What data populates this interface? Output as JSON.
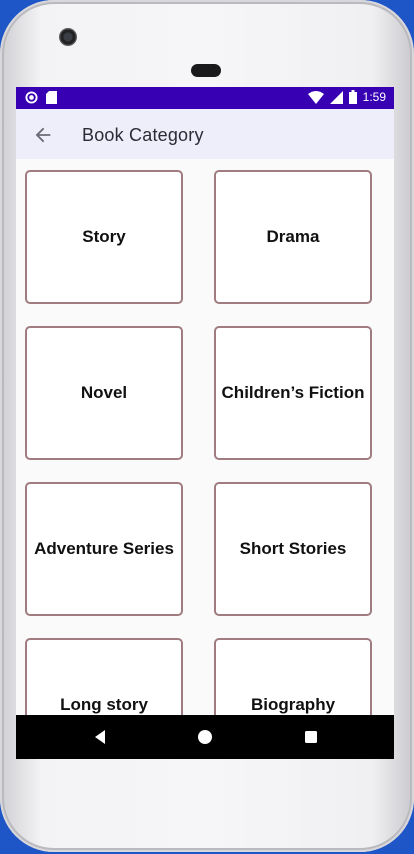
{
  "status_bar": {
    "time": "1:59",
    "icons": [
      "record-icon",
      "sd-card-icon",
      "wifi-icon",
      "signal-icon",
      "battery-icon"
    ]
  },
  "app_bar": {
    "back_icon": "arrow-left-icon",
    "title": "Book Category"
  },
  "categories": [
    {
      "label": "Story"
    },
    {
      "label": "Drama"
    },
    {
      "label": "Novel"
    },
    {
      "label": "Children’s Fiction"
    },
    {
      "label": "Adventure Series"
    },
    {
      "label": "Short Stories"
    },
    {
      "label": "Long story"
    },
    {
      "label": "Biography"
    }
  ],
  "nav_bar": {
    "icons": [
      "back-triangle-icon",
      "home-circle-icon",
      "recents-square-icon"
    ]
  },
  "colors": {
    "status_bar": "#3700b3",
    "app_bar": "#eeeefa",
    "card_border": "#a07c80"
  }
}
